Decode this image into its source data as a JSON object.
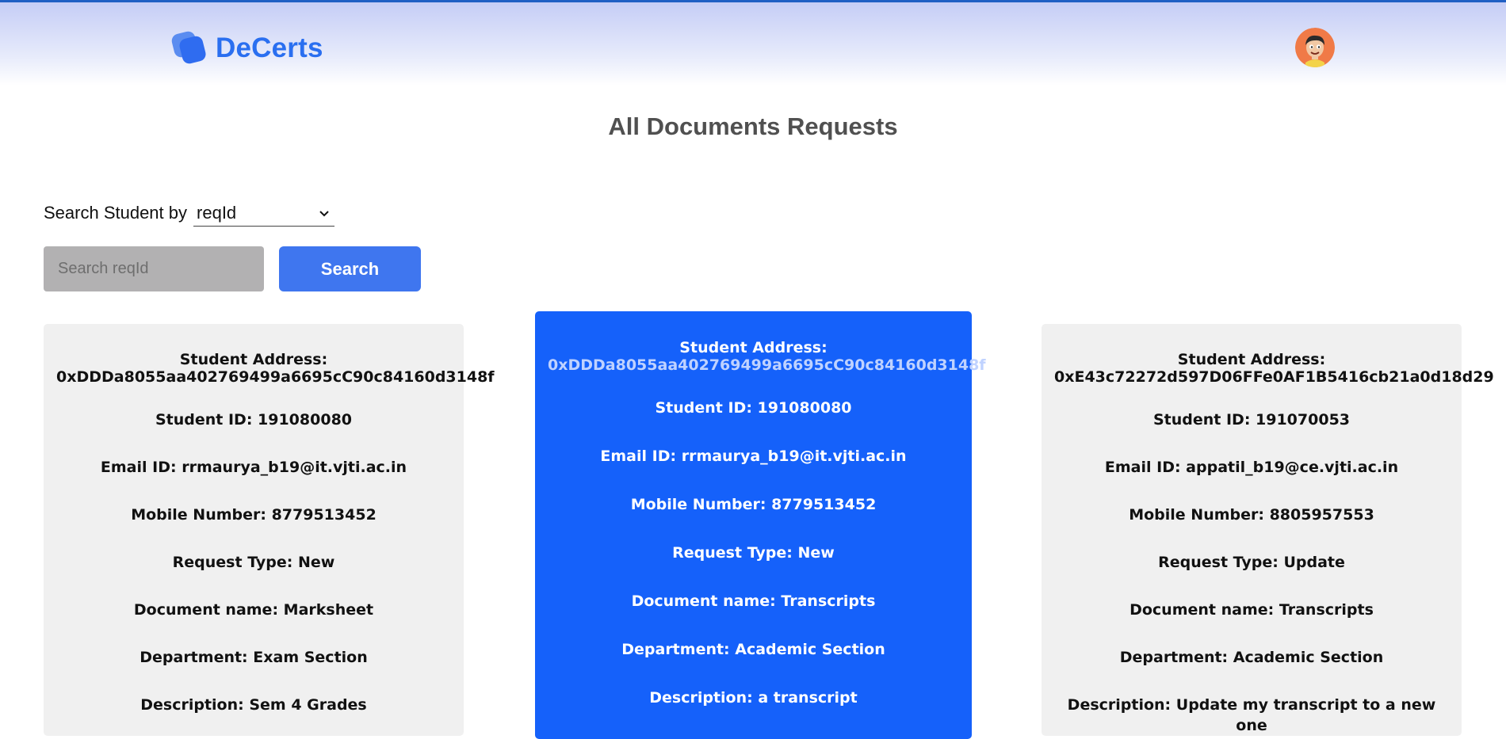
{
  "app": {
    "name": "DeCerts"
  },
  "page": {
    "title": "All Documents Requests"
  },
  "search": {
    "by_label": "Search Student by",
    "by_selected": "reqId",
    "placeholder": "Search reqId",
    "button_label": "Search"
  },
  "icons": {
    "logo": "decerts-logo-icon",
    "avatar": "user-avatar-icon",
    "dropdown": "chevron-down-icon"
  },
  "colors": {
    "brand": "#2a6ff0",
    "active_card": "#1561fa",
    "card": "#f0f0f0",
    "button": "#3f76ef"
  },
  "requests": [
    {
      "address_label": "Student Address:",
      "address": "0xDDDa8055aa402769499a6695cC90c84160d3148f",
      "student_id": "Student ID: 191080080",
      "email": "Email ID: rrmaurya_b19@it.vjti.ac.in",
      "mobile": "Mobile Number: 8779513452",
      "request_type": "Request Type: New",
      "document": "Document name: Marksheet",
      "department": "Department: Exam Section",
      "description": "Description: Sem 4 Grades"
    },
    {
      "address_label": "Student Address:",
      "address": "0xDDDa8055aa402769499a6695cC90c84160d3148f",
      "student_id": "Student ID: 191080080",
      "email": "Email ID: rrmaurya_b19@it.vjti.ac.in",
      "mobile": "Mobile Number: 8779513452",
      "request_type": "Request Type: New",
      "document": "Document name: Transcripts",
      "department": "Department: Academic Section",
      "description": "Description: a transcript"
    },
    {
      "address_label": "Student Address:",
      "address": "0xE43c72272d597D06FFe0AF1B5416cb21a0d18d29",
      "student_id": "Student ID: 191070053",
      "email": "Email ID: appatil_b19@ce.vjti.ac.in",
      "mobile": "Mobile Number: 8805957553",
      "request_type": "Request Type: Update",
      "document": "Document name: Transcripts",
      "department": "Department: Academic Section",
      "description": "Description: Update my transcript to a new one"
    }
  ]
}
